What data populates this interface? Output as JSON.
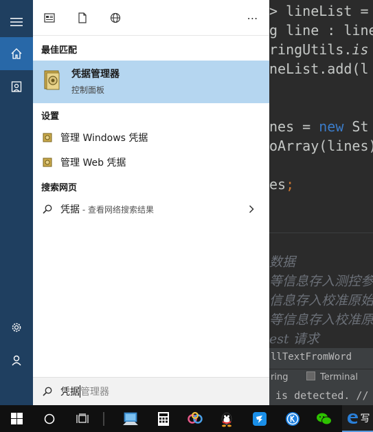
{
  "start": {
    "rail": {
      "menu_label": "menu-icon",
      "home_label": "home-icon",
      "documents_label": "documents-icon",
      "settings_label": "settings-icon",
      "user_label": "user-icon"
    },
    "toolbar": {
      "apps_icon": "apps-icon",
      "documents_icon": "document-icon",
      "web_icon": "globe-icon",
      "more_label": "⋯"
    },
    "best_match": {
      "heading": "最佳匹配",
      "title": "凭据管理器",
      "subtitle": "控制面板"
    },
    "settings": {
      "heading": "设置",
      "items": [
        {
          "label": "管理 Windows 凭据"
        },
        {
          "label": "管理 Web 凭据"
        }
      ]
    },
    "web_search": {
      "heading": "搜索网页",
      "query": "凭据",
      "suffix": " - 查看网络搜索结果"
    },
    "search_box": {
      "typed": "凭据",
      "suggestion": "管理器"
    }
  },
  "ide": {
    "lines": [
      {
        "text": "> lineList ="
      },
      {
        "text": "g line : line"
      },
      {
        "text": "ringUtils.is"
      },
      {
        "text": "neList.add(l"
      },
      {
        "text": "nes = new St"
      },
      {
        "text": "oArray(lines)"
      },
      {
        "text": "es;"
      }
    ],
    "comments": [
      {
        "text": "数据"
      },
      {
        "text": "等信息存入测控参"
      },
      {
        "text": "信息存入校准原始"
      },
      {
        "text": "等信息存入校准原"
      },
      {
        "text": "est 请求"
      }
    ],
    "tab_text": "llTextFromWord",
    "bottom_tabs": {
      "left": "ring",
      "terminal": "Terminal"
    },
    "status": " is detected. //"
  },
  "taskbar": {
    "edge_text": "写"
  },
  "colors": {
    "rail": "#1f3f60",
    "rail_active": "#2868a8",
    "selected": "#b5d6f0",
    "panel": "#ffffff",
    "taskbar": "#101010"
  }
}
